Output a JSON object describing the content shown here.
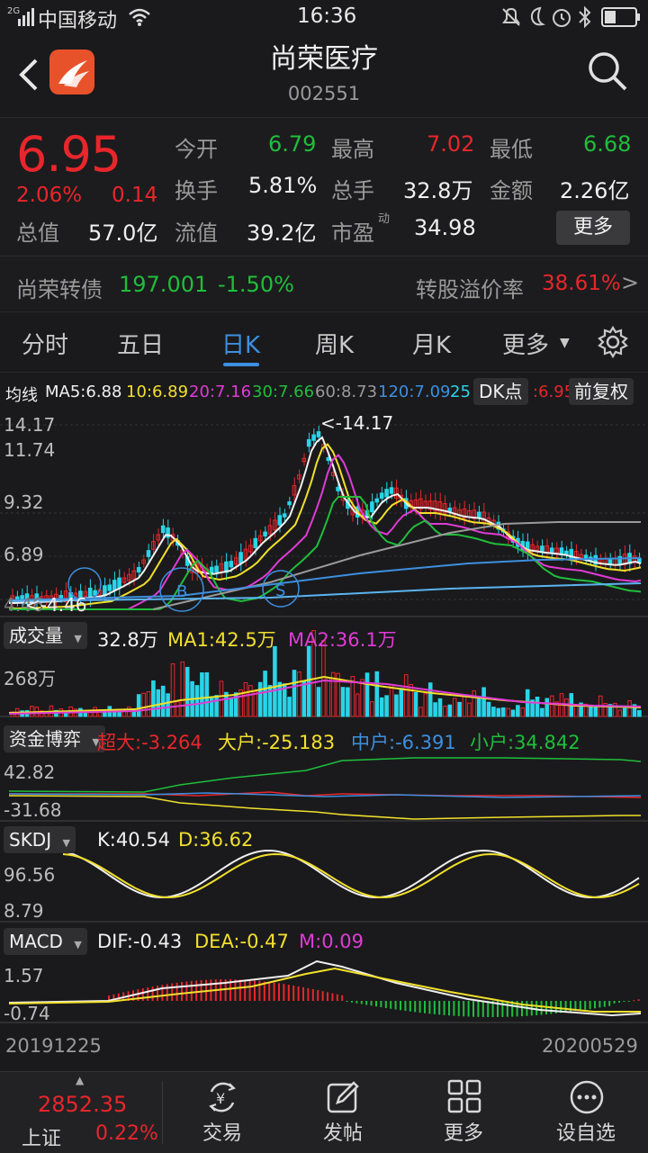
{
  "status_bar": {
    "network": "2G",
    "carrier": "中国移动",
    "time": "16:36"
  },
  "header": {
    "title": "尚荣医疗",
    "code": "002551"
  },
  "quote": {
    "price": "6.95",
    "change_pct": "2.06%",
    "change": "0.14",
    "open_label": "今开",
    "open": "6.79",
    "high_label": "最高",
    "high": "7.02",
    "low_label": "最低",
    "low": "6.68",
    "turnover_label": "换手",
    "turnover": "5.81%",
    "volume_label": "总手",
    "volume": "32.8万",
    "amount_label": "金额",
    "amount": "2.26亿",
    "total_cap_label": "总值",
    "total_cap": "57.0亿",
    "float_cap_label": "流值",
    "float_cap": "39.2亿",
    "pe_label": "市盈",
    "pe_sup": "动",
    "pe": "34.98",
    "more_button": "更多"
  },
  "bond": {
    "name": "尚荣转债",
    "price": "197.001",
    "change": "-1.50%",
    "premium_label": "转股溢价率",
    "premium": "38.61%",
    "arrow": ">"
  },
  "tabs": {
    "items": [
      "分时",
      "五日",
      "日K",
      "周K",
      "月K",
      "更多"
    ],
    "active": "日K"
  },
  "ma_line": {
    "label": "均线",
    "ma5": "MA5:6.88",
    "ma10": "10:6.89",
    "ma20": "20:7.16",
    "ma30": "30:7.66",
    "ma60": "60:8.73",
    "ma120": "120:7.09",
    "ma250": "25",
    "tail": ":6.95"
  },
  "chart_buttons": {
    "dk": "DK点",
    "adjust": "前复权"
  },
  "kline_axis": {
    "y1": "14.17",
    "y2": "11.74",
    "y3": "9.32",
    "y4": "6.89",
    "y5": "4.46",
    "max_marker": "<-14.17",
    "min_marker": "<-4.46"
  },
  "volume_panel": {
    "chip": "成交量",
    "value": "32.8万",
    "ma1": "MA1:42.5万",
    "ma2": "MA2:36.1万",
    "axis_max": "268万"
  },
  "fund_panel": {
    "chip": "资金博弈",
    "super": "超大:-3.264",
    "large": "大户:-25.183",
    "medium": "中户:-6.391",
    "small": "小户:34.842",
    "axis_top": "42.82",
    "axis_bottom": "-31.68"
  },
  "skdj_panel": {
    "chip": "SKDJ",
    "k": "K:40.54",
    "d": "D:36.62",
    "axis_top": "96.56",
    "axis_bottom": "8.79"
  },
  "macd_panel": {
    "chip": "MACD",
    "dif": "DIF:-0.43",
    "dea": "DEA:-0.47",
    "m": "M:0.09",
    "axis_top": "1.57",
    "axis_bottom": "-0.74"
  },
  "date_range": {
    "start": "20191225",
    "end": "20200529"
  },
  "bottom_nav": {
    "index_value": "2852.35",
    "index_name": "上证",
    "index_change": "0.22%",
    "items": [
      "交易",
      "发帖",
      "更多",
      "设自选"
    ]
  },
  "colors": {
    "up": "#e8262b",
    "down": "#1fbe3c",
    "accent": "#3d8fe0",
    "brand": "#e8522a"
  }
}
